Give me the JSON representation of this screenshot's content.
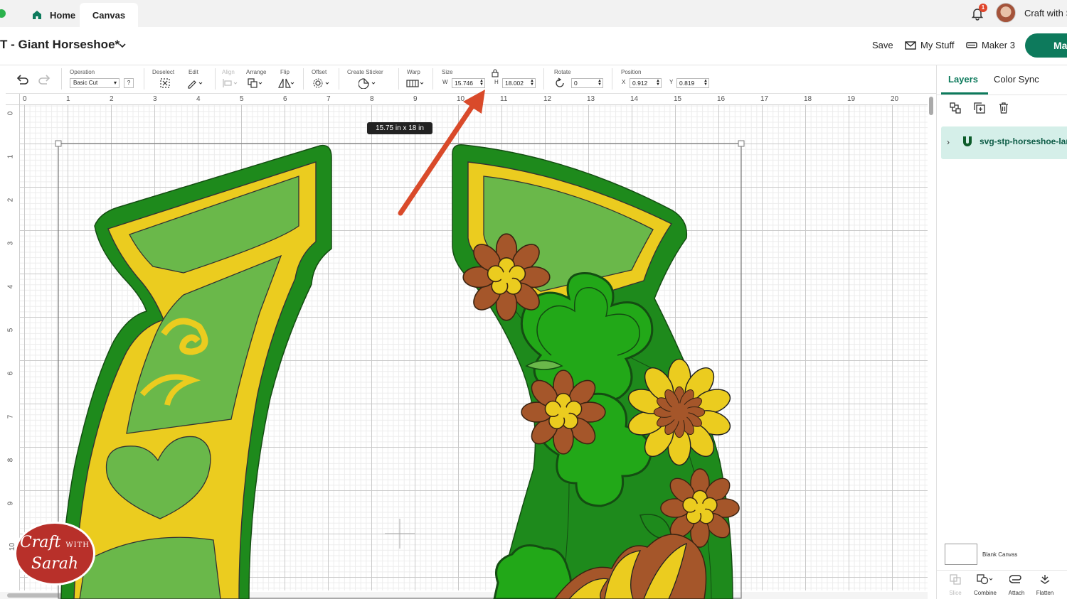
{
  "tabs": {
    "home": "Home",
    "canvas": "Canvas"
  },
  "header": {
    "notification_count": "1",
    "user_name": "Craft with Sarah"
  },
  "titlebar": {
    "project_title": "T - Giant Horseshoe*",
    "save": "Save",
    "my_stuff": "My Stuff",
    "machine": "Maker 3",
    "make": "Make"
  },
  "toolbar": {
    "operation_label": "Operation",
    "operation_value": "Basic Cut",
    "help": "?",
    "deselect": "Deselect",
    "edit": "Edit",
    "align": "Align",
    "arrange": "Arrange",
    "flip": "Flip",
    "offset": "Offset",
    "create_sticker": "Create Sticker",
    "warp": "Warp",
    "size": "Size",
    "w_letter": "W",
    "w_value": "15.746",
    "h_letter": "H",
    "h_value": "18.002",
    "rotate": "Rotate",
    "rotate_value": "0",
    "position": "Position",
    "x_letter": "X",
    "x_value": "0.912",
    "y_letter": "Y",
    "y_value": "0.819"
  },
  "canvas": {
    "size_tooltip": "15.75  in x 18  in",
    "ruler_h": [
      "0",
      "1",
      "2",
      "3",
      "4",
      "5",
      "6",
      "7",
      "8",
      "9",
      "10",
      "11",
      "12",
      "13",
      "14",
      "15",
      "16",
      "17",
      "18",
      "19",
      "20"
    ],
    "ruler_v": [
      "0",
      "1",
      "2",
      "3",
      "4",
      "5",
      "6",
      "7",
      "8",
      "9",
      "10"
    ]
  },
  "logo": {
    "line1": "Craft",
    "line2": "WITH",
    "line3": "Sarah"
  },
  "panel": {
    "tab_layers": "Layers",
    "tab_color_sync": "Color Sync",
    "layer_name": "svg-stp-horseshoe-large",
    "blank_canvas": "Blank Canvas",
    "slice": "Slice",
    "combine": "Combine",
    "attach": "Attach",
    "flatten": "Flatten"
  },
  "colors": {
    "accent": "#0d7a5c",
    "dark_green": "#1e8a1c",
    "light_green": "#6ab84a",
    "yellow": "#ebcc1f",
    "brown": "#a5562a",
    "arrow": "#d94a2a"
  }
}
